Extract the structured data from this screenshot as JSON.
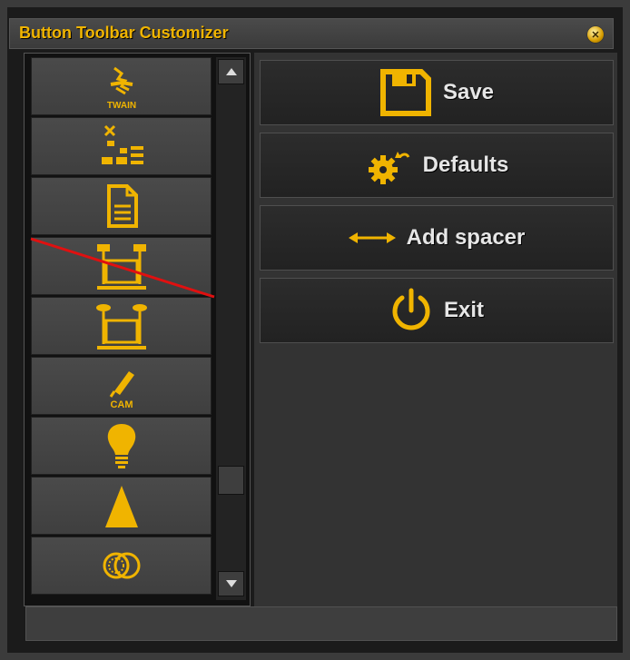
{
  "window": {
    "title": "Button Toolbar Customizer",
    "close_icon": "close-icon"
  },
  "colors": {
    "accent": "#f0b400",
    "strike": "#e01010",
    "button_text": "#e6e6e6"
  },
  "icon_list": {
    "items": [
      {
        "icon": "twain-scanner-icon",
        "caption": "TWAIN",
        "disabled": false
      },
      {
        "icon": "layout-arrange-icon",
        "caption": "",
        "disabled": false
      },
      {
        "icon": "document-icon",
        "caption": "",
        "disabled": false
      },
      {
        "icon": "dual-camera-copystand-icon",
        "caption": "",
        "disabled": true
      },
      {
        "icon": "copystand-lights-icon",
        "caption": "",
        "disabled": false
      },
      {
        "icon": "camera-pen-icon",
        "caption": "CAM",
        "disabled": false
      },
      {
        "icon": "light-bulb-icon",
        "caption": "",
        "disabled": false
      },
      {
        "icon": "triangle-icon",
        "caption": "",
        "disabled": false
      },
      {
        "icon": "color-filter-icon",
        "caption": "",
        "disabled": false
      }
    ]
  },
  "actions": {
    "save": {
      "label": "Save",
      "icon": "floppy-disk-icon"
    },
    "defaults": {
      "label": "Defaults",
      "icon": "gear-reset-icon"
    },
    "add_spacer": {
      "label": "Add spacer",
      "icon": "double-arrow-icon"
    },
    "exit": {
      "label": "Exit",
      "icon": "power-icon"
    }
  }
}
